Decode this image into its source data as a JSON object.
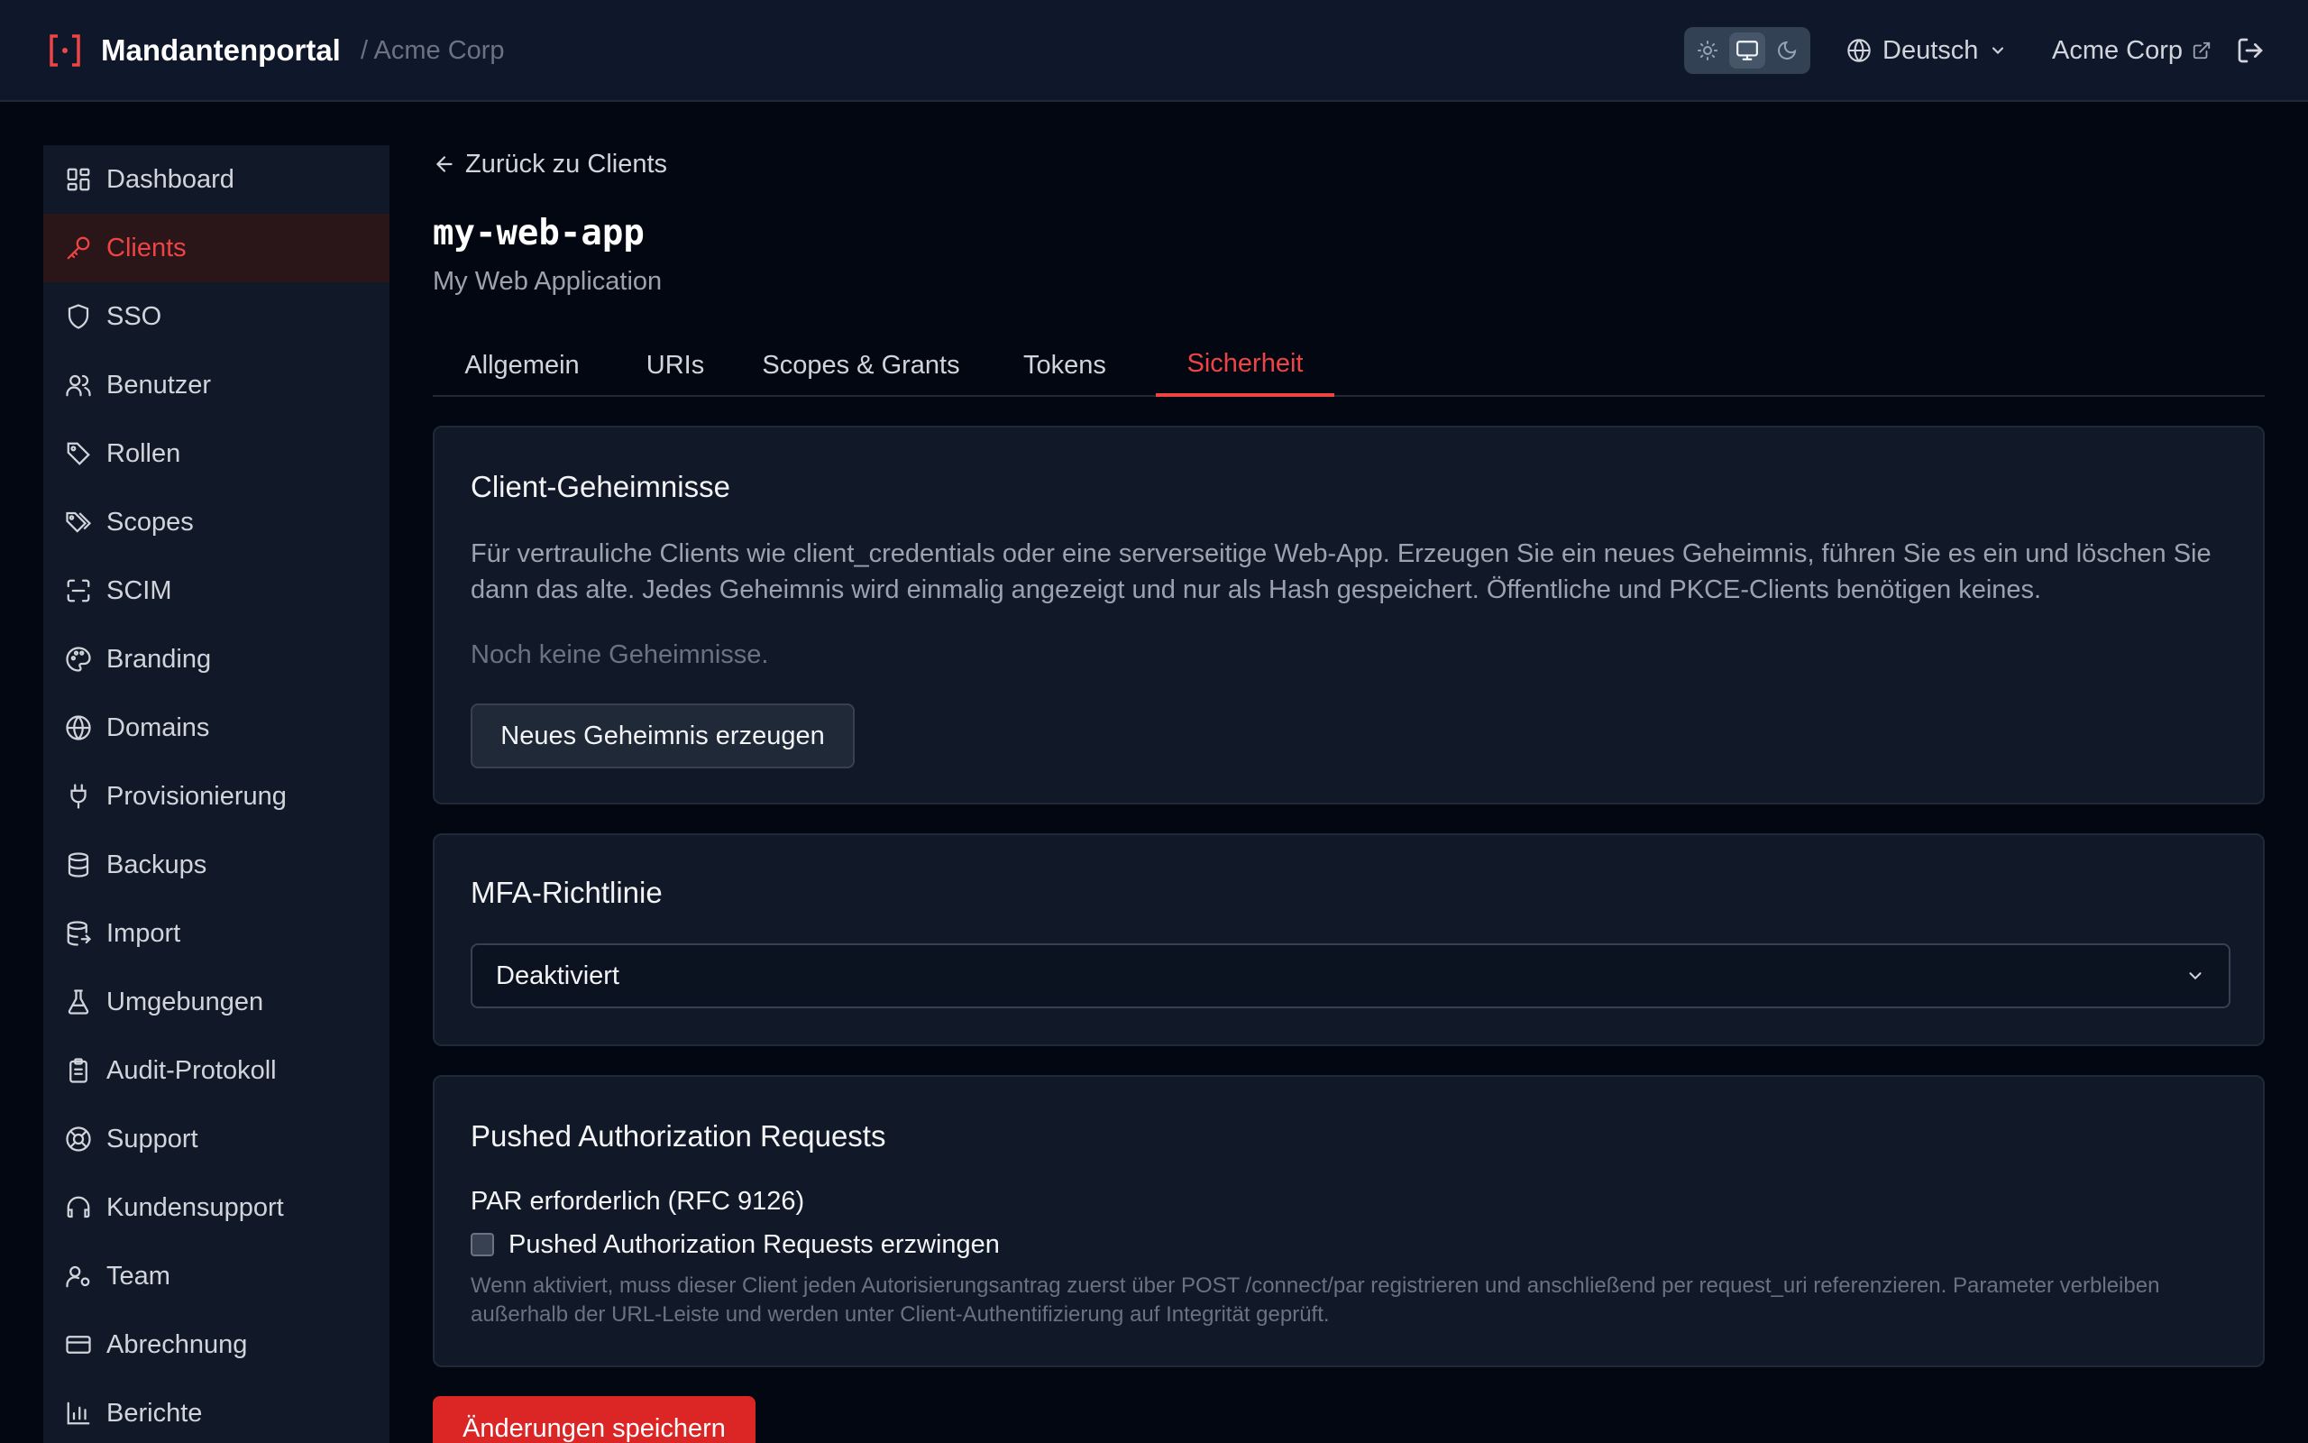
{
  "header": {
    "app_title": "Mandantenportal",
    "tenant_crumb": "/ Acme Corp",
    "language": "Deutsch",
    "tenant_link": "Acme Corp",
    "theme_options": [
      "sun-icon",
      "monitor-icon",
      "moon-icon"
    ],
    "theme_selected": "monitor-icon"
  },
  "sidebar": {
    "items": [
      {
        "label": "Dashboard",
        "icon": "dashboard-icon"
      },
      {
        "label": "Clients",
        "icon": "key-icon",
        "active": true
      },
      {
        "label": "SSO",
        "icon": "shield-icon"
      },
      {
        "label": "Benutzer",
        "icon": "users-icon"
      },
      {
        "label": "Rollen",
        "icon": "tag-icon"
      },
      {
        "label": "Scopes",
        "icon": "tags-icon"
      },
      {
        "label": "SCIM",
        "icon": "scan-icon"
      },
      {
        "label": "Branding",
        "icon": "palette-icon"
      },
      {
        "label": "Domains",
        "icon": "globe-icon"
      },
      {
        "label": "Provisionierung",
        "icon": "plug-icon"
      },
      {
        "label": "Backups",
        "icon": "database-icon"
      },
      {
        "label": "Import",
        "icon": "database-import-icon"
      },
      {
        "label": "Umgebungen",
        "icon": "flask-icon"
      },
      {
        "label": "Audit-Protokoll",
        "icon": "clipboard-icon"
      },
      {
        "label": "Support",
        "icon": "lifebuoy-icon"
      },
      {
        "label": "Kundensupport",
        "icon": "headset-icon"
      },
      {
        "label": "Team",
        "icon": "user-cog-icon"
      },
      {
        "label": "Abrechnung",
        "icon": "credit-card-icon"
      },
      {
        "label": "Berichte",
        "icon": "bar-chart-icon"
      }
    ]
  },
  "main": {
    "back_label": "Zurück zu Clients",
    "client_id": "my-web-app",
    "client_name": "My Web Application",
    "tabs": [
      {
        "label": "Allgemein"
      },
      {
        "label": "URIs"
      },
      {
        "label": "Scopes & Grants"
      },
      {
        "label": "Tokens"
      },
      {
        "label": "Sicherheit",
        "active": true
      }
    ],
    "secrets": {
      "title": "Client-Geheimnisse",
      "description": "Für vertrauliche Clients wie client_credentials oder eine serverseitige Web-App. Erzeugen Sie ein neues Geheimnis, führen Sie es ein und löschen Sie dann das alte. Jedes Geheimnis wird einmalig angezeigt und nur als Hash gespeichert. Öffentliche und PKCE-Clients benötigen keines.",
      "empty": "Noch keine Geheimnisse.",
      "button": "Neues Geheimnis erzeugen"
    },
    "mfa": {
      "title": "MFA-Richtlinie",
      "selected": "Deaktiviert"
    },
    "par": {
      "title": "Pushed Authorization Requests",
      "field_label": "PAR erforderlich (RFC 9126)",
      "checkbox_label": "Pushed Authorization Requests erzwingen",
      "checked": false,
      "help": "Wenn aktiviert, muss dieser Client jeden Autorisierungsantrag zuerst über POST /connect/par registrieren und anschließend per request_uri referenzieren. Parameter verbleiben außerhalb der URL-Leiste und werden unter Client-Authentifizierung auf Integrität geprüft."
    },
    "save_button": "Änderungen speichern"
  },
  "colors": {
    "accent": "#ef4444",
    "primary_button": "#dc2626",
    "background": "#030712",
    "surface": "#111827"
  }
}
